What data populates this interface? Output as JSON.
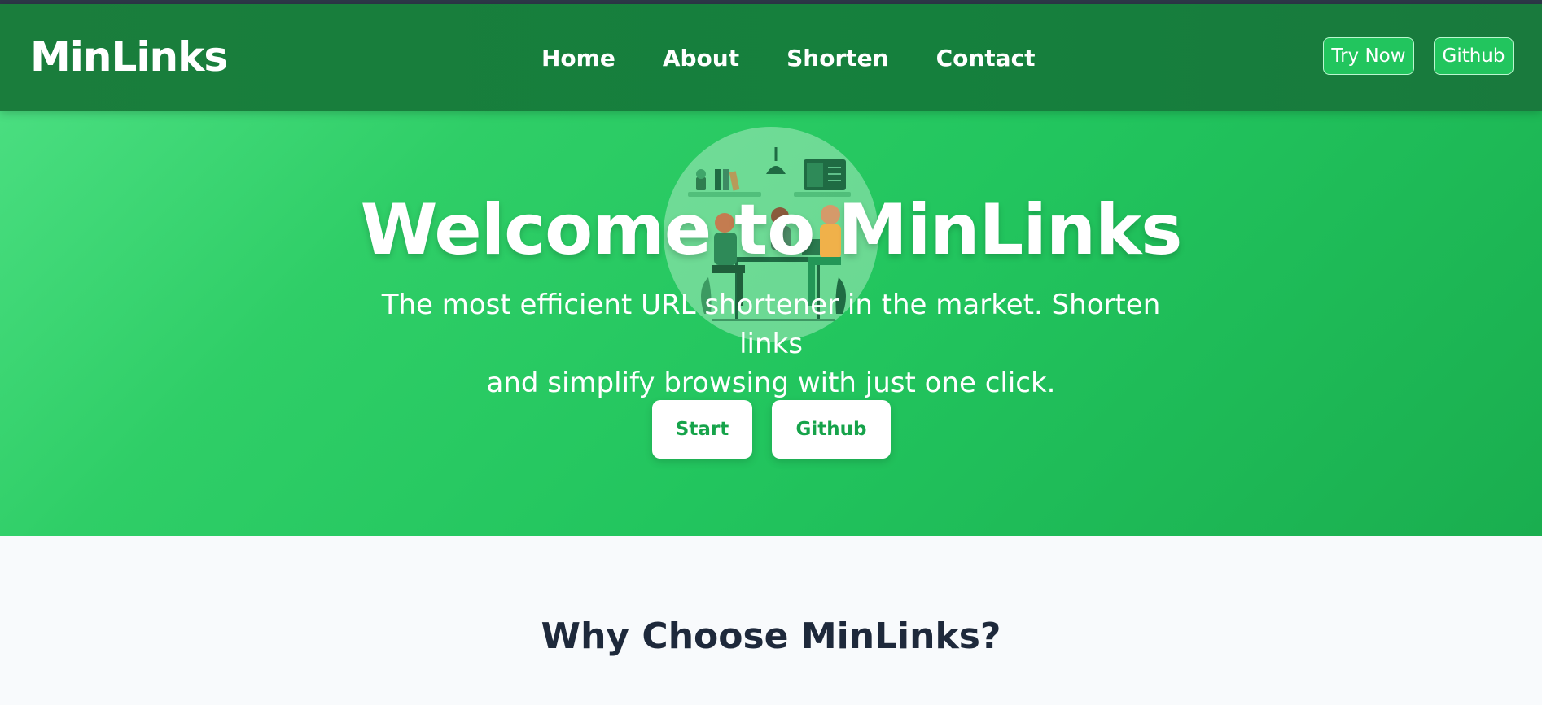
{
  "nav": {
    "brand": "MinLinks",
    "links": [
      "Home",
      "About",
      "Shorten",
      "Contact"
    ],
    "try_now": "Try Now",
    "github": "Github"
  },
  "hero": {
    "title": "Welcome to MinLinks",
    "subtitle_line1": "The most efficient URL shortener in the market. Shorten links",
    "subtitle_line2": "and simplify browsing with just one click.",
    "start_label": "Start",
    "github_label": "Github",
    "illustration": "team-working-illustration"
  },
  "features": {
    "heading": "Why Choose MinLinks?"
  },
  "colors": {
    "nav_bg": "#15803d",
    "hero_bg": "#22c55e",
    "button_text": "#16a34a",
    "heading_text": "#1e293b"
  }
}
